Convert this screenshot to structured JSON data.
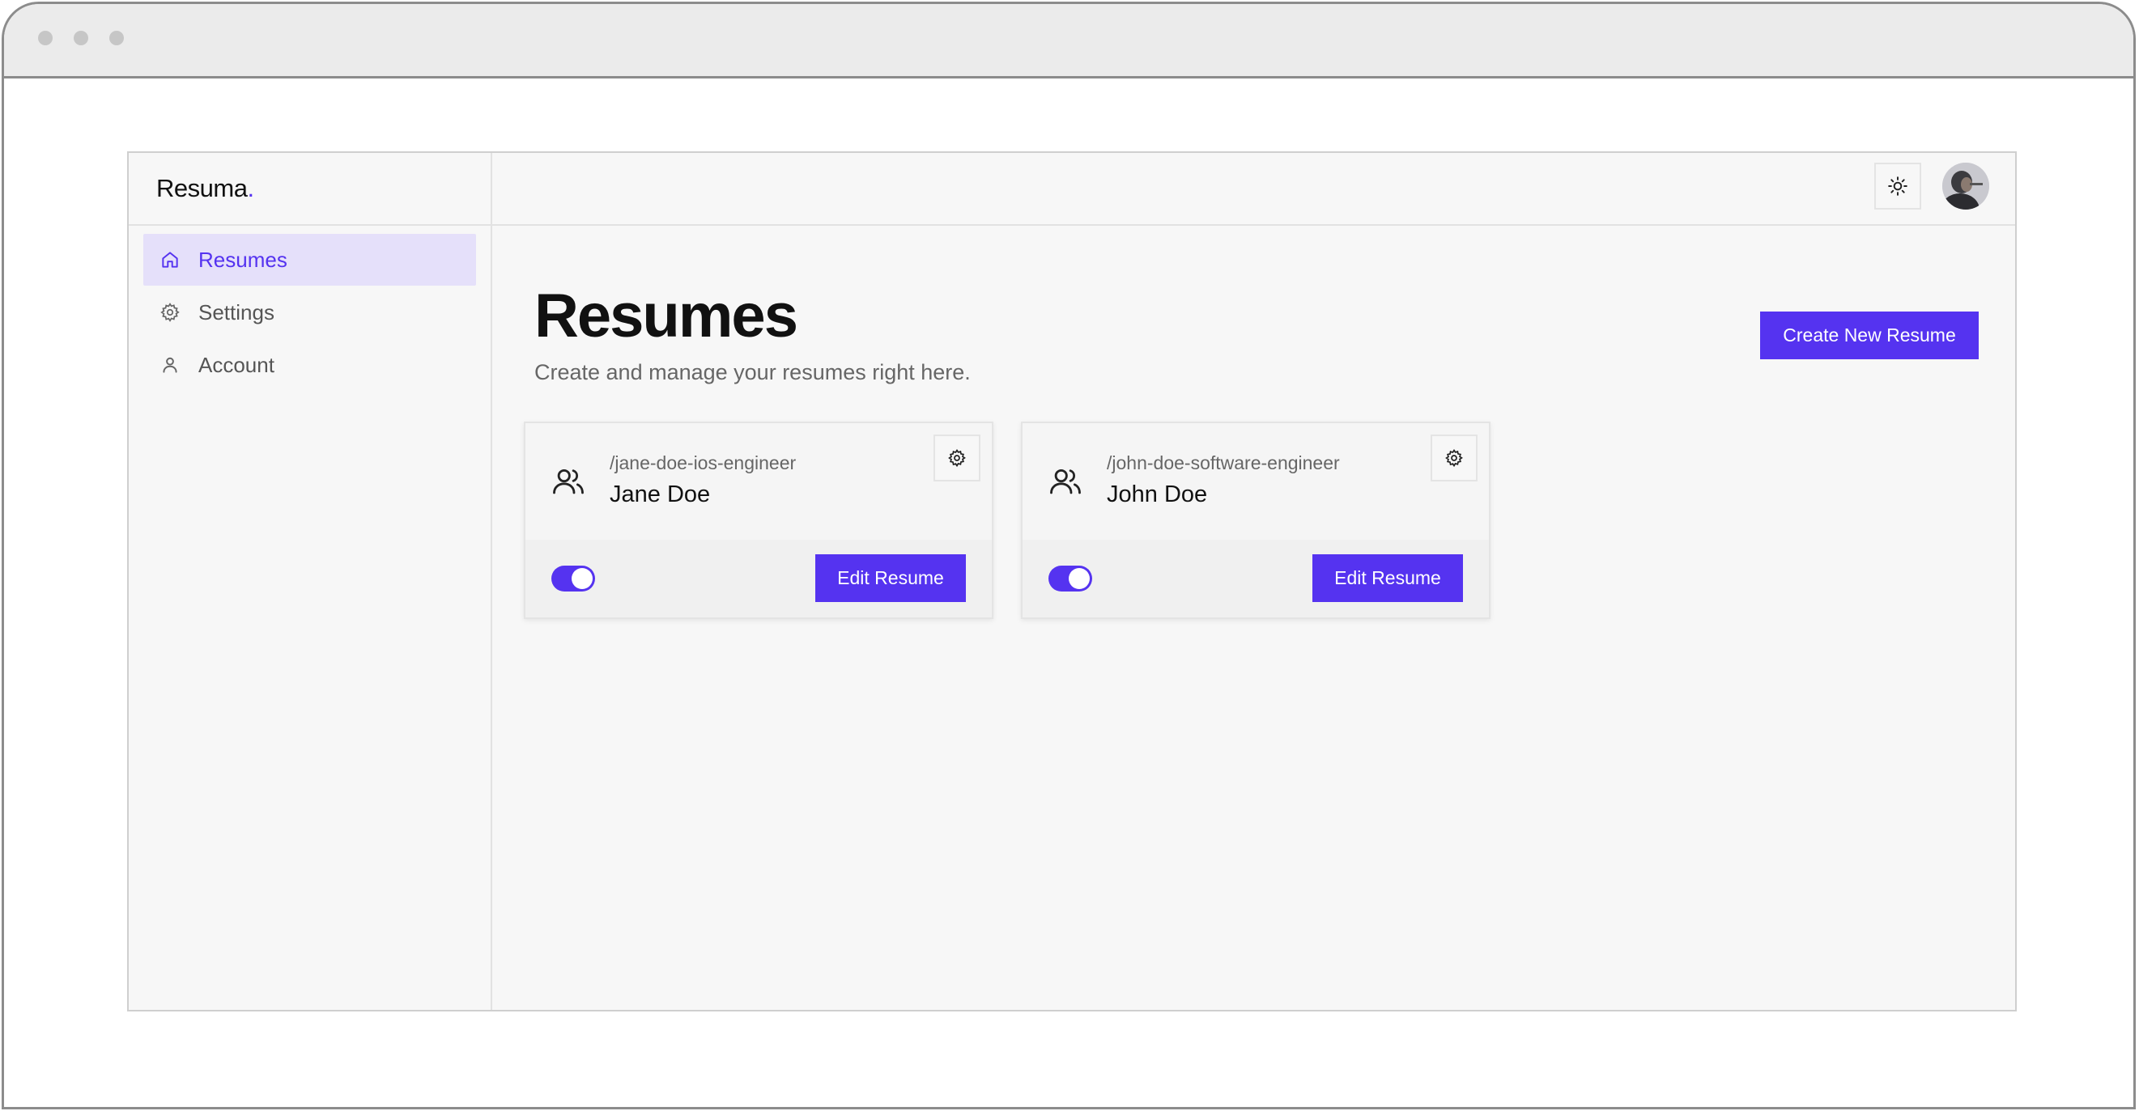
{
  "window": {
    "dots": 3
  },
  "app": {
    "logo": {
      "text": "Resuma",
      "dot": "."
    },
    "sidebar": {
      "items": [
        {
          "label": "Resumes",
          "icon": "home-icon",
          "active": true
        },
        {
          "label": "Settings",
          "icon": "gear-icon",
          "active": false
        },
        {
          "label": "Account",
          "icon": "user-icon",
          "active": false
        }
      ]
    },
    "topbar": {
      "theme_icon": "sun-icon",
      "avatar": "avatar"
    },
    "page": {
      "title": "Resumes",
      "subtitle": "Create and manage your resumes right here.",
      "create_label": "Create New Resume"
    },
    "cards": [
      {
        "slug": "/jane-doe-ios-engineer",
        "name": "Jane Doe",
        "published": true,
        "edit_label": "Edit Resume"
      },
      {
        "slug": "/john-doe-software-engineer",
        "name": "John Doe",
        "published": true,
        "edit_label": "Edit Resume"
      }
    ]
  },
  "colors": {
    "accent": "#5533f0",
    "active_bg": "#e5e0fa",
    "background": "#f7f7f7"
  }
}
